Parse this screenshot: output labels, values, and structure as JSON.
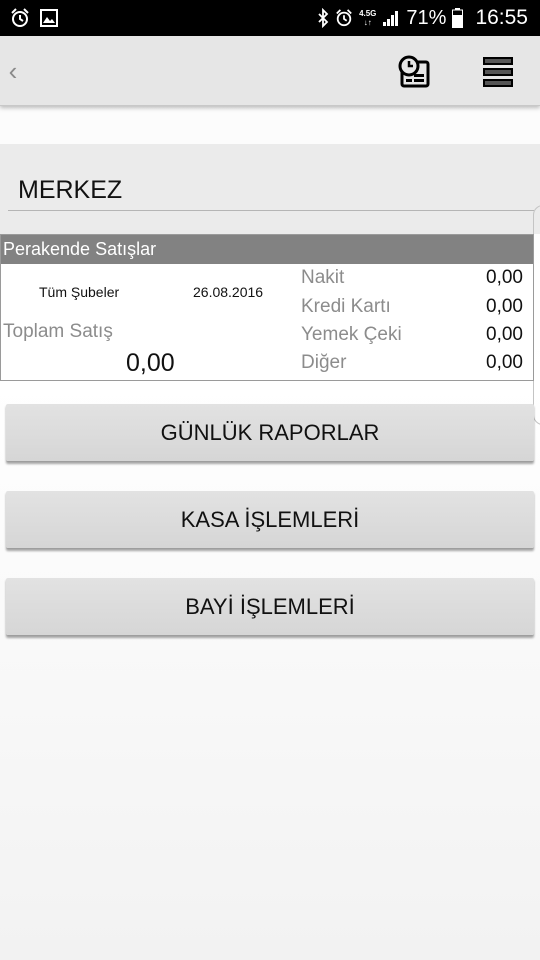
{
  "status_bar": {
    "battery": "71%",
    "time": "16:55",
    "network_top": "4.5G",
    "network_bottom": "↓↑",
    "icons": [
      "alarm-icon",
      "image-icon",
      "bluetooth-icon",
      "alarm-icon",
      "signal-icon",
      "battery-icon"
    ]
  },
  "toolbar": {
    "back_label": "‹",
    "icons": [
      "report-clock-icon",
      "list-menu-icon"
    ]
  },
  "location": "MERKEZ",
  "sales": {
    "title": "Perakende Satışlar",
    "branch": "Tüm Şubeler",
    "date": "26.08.2016",
    "total_label": "Toplam Satış",
    "total_value": "0,00",
    "payments": [
      {
        "label": "Nakit",
        "value": "0,00"
      },
      {
        "label": "Kredi Kartı",
        "value": "0,00"
      },
      {
        "label": "Yemek Çeki",
        "value": "0,00"
      },
      {
        "label": "Diğer",
        "value": "0,00"
      }
    ]
  },
  "buttons": {
    "daily_reports": "GÜNLÜK RAPORLAR",
    "cash_operations": "KASA İŞLEMLERİ",
    "dealer_operations": "BAYİ İŞLEMLERİ"
  }
}
